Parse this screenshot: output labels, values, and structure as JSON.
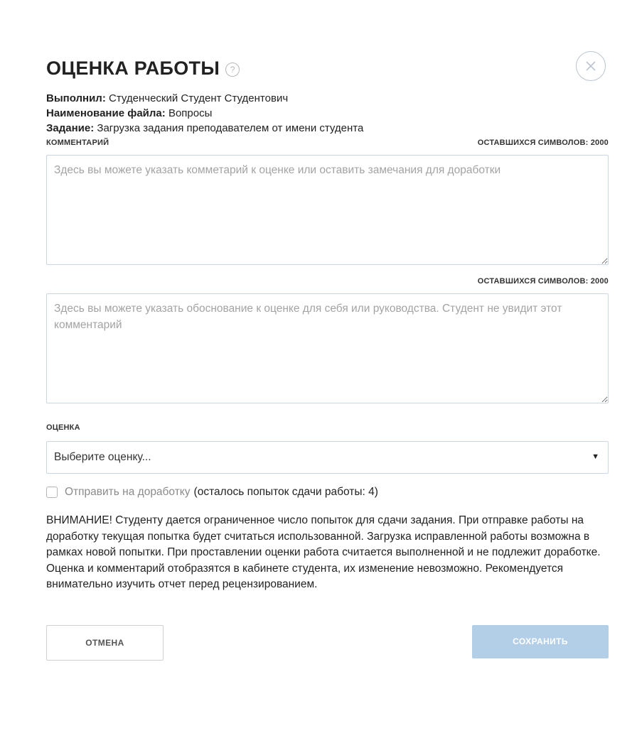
{
  "dialog": {
    "title": "ОЦЕНКА РАБОТЫ",
    "help_icon": "question-circle-icon",
    "close_icon": "close-circle-icon"
  },
  "meta": {
    "performer_label": "Выполнил:",
    "performer_value": "Студенческий Студент Студентович",
    "filename_label": "Наименование файла:",
    "filename_value": "Вопросы",
    "task_label": "Задание:",
    "task_value": "Загрузка задания преподавателем от имени студента"
  },
  "comment": {
    "label": "КОММЕНТАРИЙ",
    "remaining": "ОСТАВШИХСЯ СИМВОЛОВ: 2000",
    "value": "",
    "placeholder": "Здесь вы можете указать комметарий к оценке или оставить замечания для доработки"
  },
  "justification": {
    "remaining": "ОСТАВШИХСЯ СИМВОЛОВ: 2000",
    "value": "",
    "placeholder": "Здесь вы можете указать обоснование к оценке для себя или руководства. Студент не увидит этот комментарий"
  },
  "grade": {
    "label": "ОЦЕНКА",
    "selected": "Выберите оценку...",
    "arrow_icon": "triangle-down-icon"
  },
  "rework": {
    "checked": false,
    "label": "Отправить на доработку",
    "note": "(осталось попыток сдачи работы: 4)"
  },
  "warning_text": "ВНИМАНИЕ! Студенту дается ограниченное число попыток для сдачи задания. При отправке работы на доработку текущая попытка будет считаться использованной. Загрузка исправленной работы возможна в рамках новой попытки. При проставлении оценки работа считается выполненной и не подлежит доработке. Оценка и комментарий отобразятся в кабинете студента, их изменение невозможно. Рекомендуется внимательно изучить отчет перед рецензированием.",
  "buttons": {
    "cancel": "ОТМЕНА",
    "save": "СОХРАНИТЬ"
  },
  "colors": {
    "save_button_bg": "#b3cfe7",
    "input_border": "#c9d6e3",
    "close_border": "#bcc5d0"
  }
}
